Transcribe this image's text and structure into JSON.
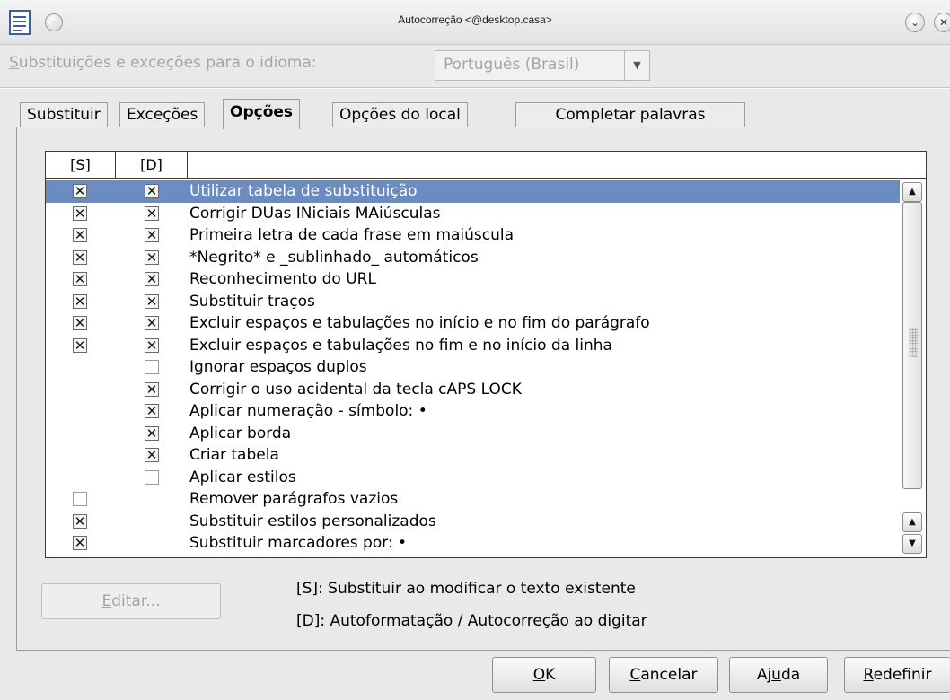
{
  "window": {
    "title": "Autocorreção <@desktop.casa>",
    "app_icon": "document-icon",
    "controls": [
      "minimize-icon",
      "close-icon"
    ]
  },
  "language": {
    "label": "Substituições e exceções para o idioma:",
    "selected": "Português (Brasil)"
  },
  "tabs": [
    {
      "label": "Substituir",
      "active": false
    },
    {
      "label": "Exceções",
      "active": false
    },
    {
      "label": "Opções",
      "active": true
    },
    {
      "label": "Opções do local",
      "active": false
    },
    {
      "label": "Completar palavras",
      "active": false
    }
  ],
  "options": {
    "headers": {
      "s": "[S]",
      "d": "[D]",
      "label": ""
    },
    "rows": [
      {
        "label": "Utilizar tabela de substituição",
        "s": true,
        "d": true,
        "selected": true
      },
      {
        "label": "Corrigir DUas INiciais MAiúsculas",
        "s": true,
        "d": true
      },
      {
        "label": "Primeira letra de cada frase em maiúscula",
        "s": true,
        "d": true
      },
      {
        "label": "*Negrito* e _sublinhado_ automáticos",
        "s": true,
        "d": true
      },
      {
        "label": "Reconhecimento do URL",
        "s": true,
        "d": true
      },
      {
        "label": "Substituir traços",
        "s": true,
        "d": true
      },
      {
        "label": "Excluir espaços e tabulações no início e no fim do parágrafo",
        "s": true,
        "d": true
      },
      {
        "label": "Excluir espaços e tabulações no fim e no início da linha",
        "s": true,
        "d": true
      },
      {
        "label": "Ignorar espaços duplos",
        "s": null,
        "d": false
      },
      {
        "label": "Corrigir o uso acidental da tecla cAPS LOCK",
        "s": null,
        "d": true
      },
      {
        "label": "Aplicar numeração - símbolo: •",
        "s": null,
        "d": true
      },
      {
        "label": "Aplicar borda",
        "s": null,
        "d": true
      },
      {
        "label": "Criar tabela",
        "s": null,
        "d": true
      },
      {
        "label": "Aplicar estilos",
        "s": null,
        "d": false
      },
      {
        "label": "Remover parágrafos vazios",
        "s": false,
        "d": null
      },
      {
        "label": "Substituir estilos personalizados",
        "s": true,
        "d": null
      },
      {
        "label": "Substituir marcadores por: •",
        "s": true,
        "d": null
      }
    ]
  },
  "edit_button": "Editar...",
  "legend": {
    "s": "[S]: Substituir ao modificar o texto existente",
    "d": "[D]: Autoformatação / Autocorreção ao digitar"
  },
  "buttons": {
    "ok": "OK",
    "cancel": "Cancelar",
    "help": "Ajuda",
    "reset": "Redefinir"
  },
  "colors": {
    "selection": "#6b8cc0",
    "window_bg": "#e9e9e9"
  }
}
